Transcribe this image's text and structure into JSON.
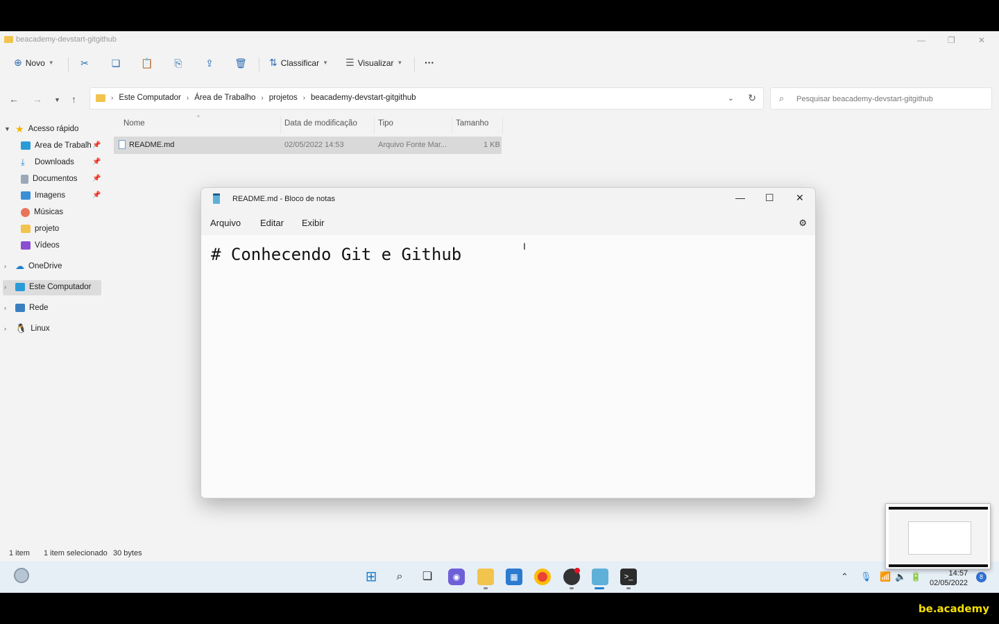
{
  "explorer": {
    "window_title": "beacademy-devstart-gitgithub",
    "toolbar": {
      "new_label": "Novo",
      "sort_label": "Classificar",
      "view_label": "Visualizar",
      "more_label": "···"
    },
    "breadcrumbs": [
      "Este Computador",
      "Área de Trabalho",
      "projetos",
      "beacademy-devstart-gitgithub"
    ],
    "search_placeholder": "Pesquisar beacademy-devstart-gitgithub",
    "sidebar": {
      "quick_access": "Acesso rápido",
      "items": [
        {
          "label": "Área de Trabalho",
          "icon": "desktop-icon",
          "pinned": true
        },
        {
          "label": "Downloads",
          "icon": "download-icon",
          "pinned": true
        },
        {
          "label": "Documentos",
          "icon": "documents-icon",
          "pinned": true
        },
        {
          "label": "Imagens",
          "icon": "pictures-icon",
          "pinned": true
        },
        {
          "label": "Músicas",
          "icon": "music-icon",
          "pinned": false
        },
        {
          "label": "projeto",
          "icon": "folder-icon",
          "pinned": false
        },
        {
          "label": "Vídeos",
          "icon": "videos-icon",
          "pinned": false
        }
      ],
      "onedrive": "OneDrive",
      "this_pc": "Este Computador",
      "network": "Rede",
      "linux": "Linux"
    },
    "columns": {
      "name": "Nome",
      "modified": "Data de modificação",
      "type": "Tipo",
      "size": "Tamanho"
    },
    "files": [
      {
        "name": "README.md",
        "modified": "02/05/2022 14:53",
        "type": "Arquivo Fonte Mar...",
        "size": "1 KB"
      }
    ],
    "status": {
      "count": "1 item",
      "selected": "1 item selecionado",
      "bytes": "30 bytes"
    }
  },
  "notepad": {
    "title": "README.md - Bloco de notas",
    "menu": [
      "Arquivo",
      "Editar",
      "Exibir"
    ],
    "content": "# Conhecendo Git e Github"
  },
  "taskbar": {
    "time": "14:57",
    "date": "02/05/2022",
    "notifications": "8"
  },
  "brand": "be.academy"
}
